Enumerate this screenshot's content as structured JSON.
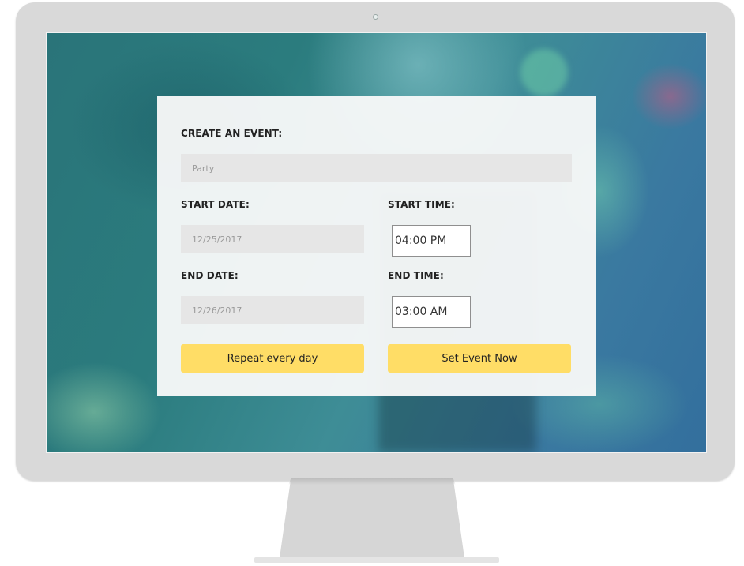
{
  "form": {
    "title": "CREATE AN EVENT:",
    "event_name_placeholder": "Party",
    "start_date_label": "START DATE:",
    "start_date_value": "12/25/2017",
    "start_time_label": "START TIME:",
    "start_time_value": "04:00 PM",
    "end_date_label": "END DATE:",
    "end_date_value": "12/26/2017",
    "end_time_label": "END TIME:",
    "end_time_value": "03:00 AM",
    "repeat_button": "Repeat every day",
    "submit_button": "Set Event Now"
  },
  "colors": {
    "button": "#ffdd66",
    "field": "#e6e6e6",
    "card": "#f7f8f8",
    "monitor": "#d9d9d9"
  }
}
